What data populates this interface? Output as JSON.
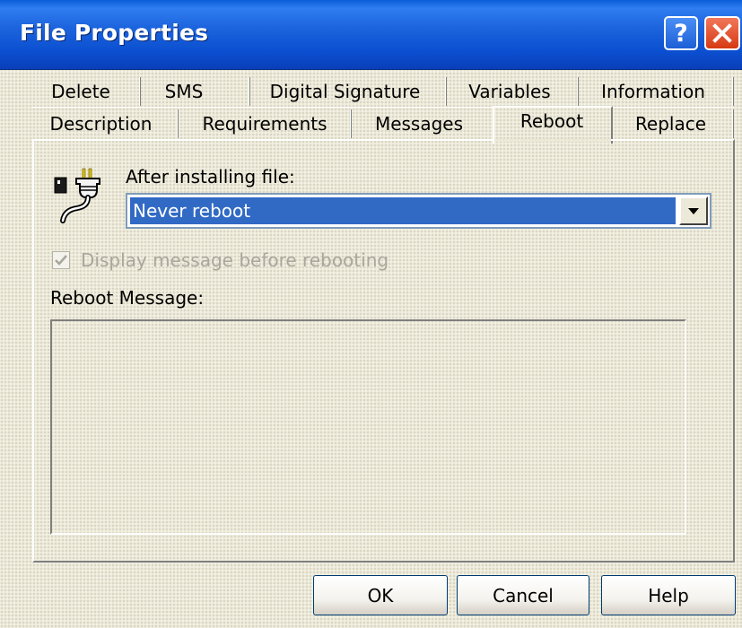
{
  "window": {
    "title": "File Properties",
    "help_button": "?",
    "close_button": "close-icon"
  },
  "tabs": {
    "row1": [
      "Delete",
      "SMS",
      "Digital Signature",
      "Variables",
      "Information"
    ],
    "row2": [
      "Description",
      "Requirements",
      "Messages",
      "Reboot",
      "Replace"
    ],
    "active": "Reboot"
  },
  "reboot": {
    "icon": "power-plug-icon",
    "after_installing_label": "After installing file:",
    "after_installing_value": "Never reboot",
    "display_message_label": "Display message before rebooting",
    "display_message_checked": true,
    "display_message_enabled": false,
    "reboot_message_label": "Reboot Message:",
    "reboot_message_value": ""
  },
  "buttons": {
    "ok": "OK",
    "cancel": "Cancel",
    "help": "Help"
  },
  "colors": {
    "titlebar": "#0b4fd0",
    "selection": "#316ac5",
    "dialog_bg": "#ece9d8"
  }
}
